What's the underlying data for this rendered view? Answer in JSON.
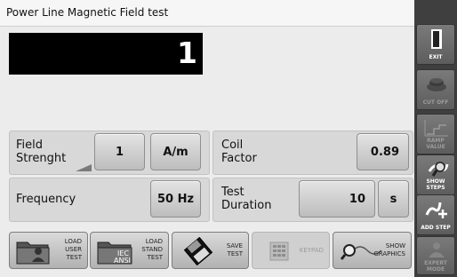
{
  "title": "Power Line Magnetic Field test",
  "display_value": "1",
  "field_strength": {
    "label_line1": "Field",
    "label_line2": "Strenght",
    "value": "1",
    "unit": "A/m"
  },
  "coil_factor": {
    "label_line1": "Coil",
    "label_line2": "Factor",
    "value": "0.89"
  },
  "frequency": {
    "label": "Frequency",
    "value": "50 Hz"
  },
  "test_duration": {
    "label_line1": "Test",
    "label_line2": "Duration",
    "value": "10",
    "unit": "s"
  },
  "toolbar": {
    "load_user_test": [
      "LOAD",
      "USER",
      "TEST"
    ],
    "load_stand_test": [
      "LOAD",
      "STAND",
      "TEST"
    ],
    "iec_ansi_icon_text": [
      "IEC",
      "ANSI"
    ],
    "save_test": [
      "SAVE",
      "TEST"
    ],
    "keypad": "KEYPAD",
    "show_graphics": [
      "SHOW",
      "GRAPHICS"
    ]
  },
  "sidebar": {
    "exit": "EXIT",
    "cut_off": "CUT OFF",
    "ramp_value": "RAMP VALUE",
    "show_steps": "SHOW STEPS",
    "add_step": "ADD STEP",
    "expert_mode": [
      "EXPERT",
      "MODE"
    ]
  },
  "colors": {
    "display_bg": "#000000",
    "sidebar_bg": "#3f3f3f",
    "panel_bg": "#d8d8d8"
  }
}
